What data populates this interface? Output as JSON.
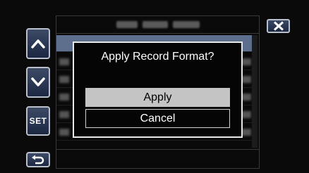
{
  "dialog": {
    "title": "Apply Record Format?",
    "apply_label": "Apply",
    "cancel_label": "Cancel"
  },
  "side_buttons": {
    "up_icon": "chevron-up-icon",
    "down_icon": "chevron-down-icon",
    "set_label": "SET",
    "back_icon": "return-arrow-icon"
  },
  "close_icon": "close-icon",
  "colors": {
    "accent_button": "#2a3753",
    "selected_row": "#5d6f8c",
    "apply_highlight": "#c4c4c4"
  }
}
